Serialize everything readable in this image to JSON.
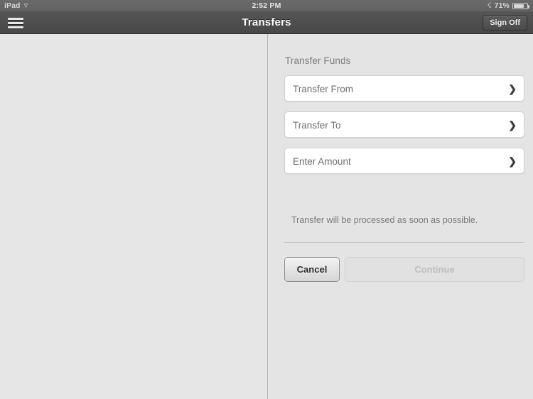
{
  "statusbar": {
    "device_label": "iPad",
    "wifi_icon": "wifi-icon",
    "time": "2:52 PM",
    "bluetooth_icon": "bluetooth-icon",
    "battery_percent": "71%",
    "battery_icon": "battery-icon"
  },
  "navbar": {
    "menu_icon": "hamburger-menu-icon",
    "title": "Transfers",
    "sign_off_label": "Sign Off"
  },
  "form": {
    "section_title": "Transfer Funds",
    "fields": [
      {
        "label": "Transfer From",
        "chevron": "❯",
        "icon": "chevron-right-icon"
      },
      {
        "label": "Transfer To",
        "chevron": "❯",
        "icon": "chevron-right-icon"
      },
      {
        "label": "Enter Amount",
        "chevron": "❯",
        "icon": "chevron-right-icon"
      }
    ],
    "helper_text": "Transfer will be processed as soon as possible.",
    "cancel_label": "Cancel",
    "continue_label": "Continue"
  },
  "colors": {
    "navbar": "#4e4e4e",
    "page_background": "#e4e4e4",
    "field_background": "#ffffff",
    "field_border": "#cfcfcf",
    "label_text": "#6e6e6e",
    "muted_text": "#7a7a7a",
    "disabled_text": "#bdbdbd"
  }
}
